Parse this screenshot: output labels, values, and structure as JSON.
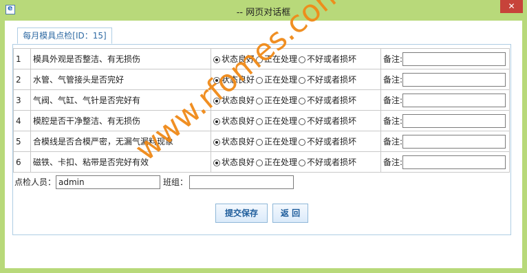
{
  "window": {
    "title": "-- 网页对话框",
    "close_label": "✕"
  },
  "tab": {
    "label": "每月模具点检[ID：15]"
  },
  "options": [
    "状态良好",
    "正在处理",
    "不好或者损坏"
  ],
  "note_label": "备注:",
  "rows": [
    {
      "num": "1",
      "item": "模具外观是否整洁、有无损伤",
      "selected": 0
    },
    {
      "num": "2",
      "item": "水管、气管接头是否完好",
      "selected": 0
    },
    {
      "num": "3",
      "item": "气阀、气缸、气针是否完好有",
      "selected": 0
    },
    {
      "num": "4",
      "item": "模腔是否干净整洁、有无损伤",
      "selected": 0
    },
    {
      "num": "5",
      "item": "合模线是否合模严密，无漏气漏料现象",
      "selected": 0
    },
    {
      "num": "6",
      "item": "磁铁、卡扣、粘带是否完好有效",
      "selected": 0
    }
  ],
  "inspector": {
    "label": "点检人员：",
    "value": "admin"
  },
  "team": {
    "label": "班组：",
    "value": ""
  },
  "buttons": {
    "submit": "提交保存",
    "back": "返 回"
  },
  "watermark": {
    "text": "www.rfomes.com"
  }
}
